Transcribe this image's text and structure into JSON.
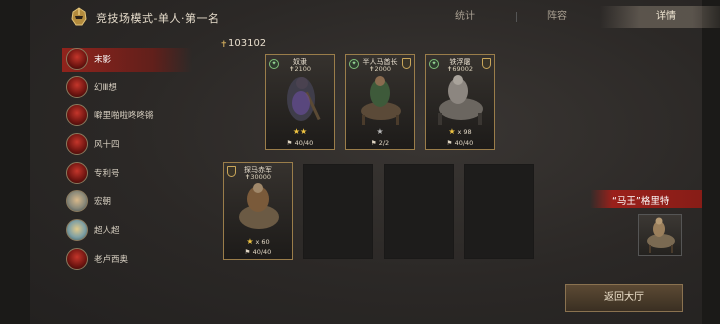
{
  "header": {
    "title": "竞技场模式-单人·第一名",
    "tabs": [
      {
        "label": "统计",
        "active": false
      },
      {
        "label": "阵容",
        "active": false
      },
      {
        "label": "详情",
        "active": true
      }
    ]
  },
  "players": [
    {
      "name": "末影",
      "active": true
    },
    {
      "name": "幻Ⅲ想",
      "active": false
    },
    {
      "name": "噼里啪啦咚咚锵",
      "active": false
    },
    {
      "name": "风十四",
      "active": false
    },
    {
      "name": "专利号",
      "active": false
    },
    {
      "name": "宏朝",
      "active": false
    },
    {
      "name": "超人超",
      "active": false
    },
    {
      "name": "老卢西奥",
      "active": false
    }
  ],
  "score": "103102",
  "units": [
    {
      "name": "奴隶",
      "power": "2100",
      "stars": "★★",
      "multiplier": "",
      "troops": "40/40"
    },
    {
      "name": "半人马酋长",
      "power": "2000",
      "stars": "★",
      "multiplier": "",
      "troops": "2/2"
    },
    {
      "name": "铁浮屠",
      "power": "69002",
      "stars": "★",
      "multiplier": "x 98",
      "troops": "40/40"
    },
    {
      "name": "探马赤军",
      "power": "30000",
      "stars": "★",
      "multiplier": "x 60",
      "troops": "40/40"
    }
  ],
  "hero": {
    "title": "“马王”格里特"
  },
  "buttons": {
    "return": "返回大厅"
  },
  "colors": {
    "accent_red": "#a0201a",
    "gold": "#c9a65a",
    "star": "#f1c542"
  }
}
